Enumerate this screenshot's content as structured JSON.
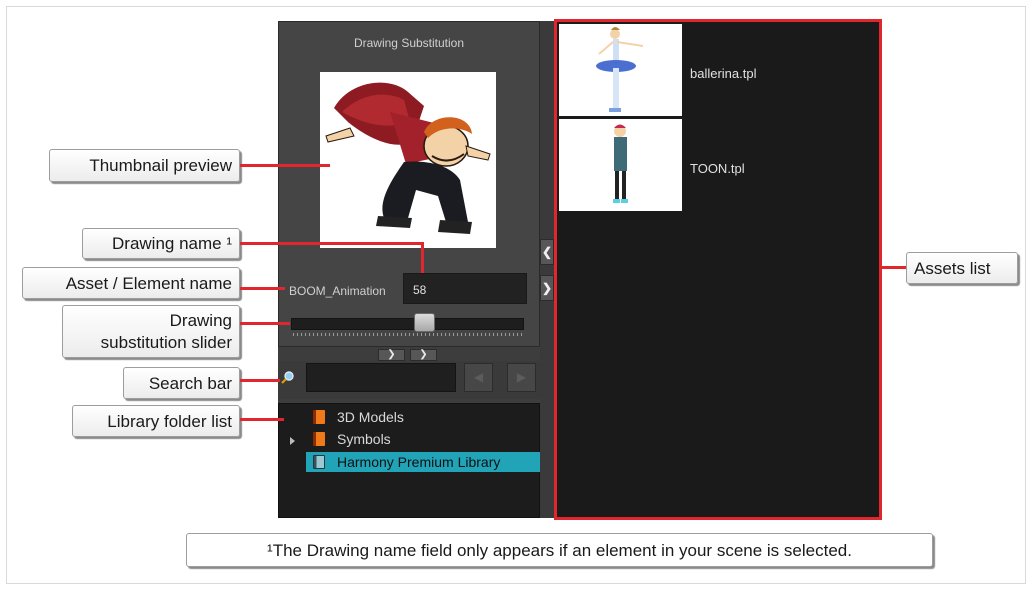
{
  "substitution": {
    "title": "Drawing Substitution",
    "asset_name": "BOOM_Animation",
    "drawing_name": "58",
    "slider_level": 0.58
  },
  "library": {
    "folders": [
      {
        "label": "3D Models",
        "expandable": false,
        "selected": false
      },
      {
        "label": "Symbols",
        "expandable": true,
        "selected": false
      },
      {
        "label": "Harmony Premium Library",
        "expandable": false,
        "selected": true
      }
    ]
  },
  "assets": [
    {
      "name": "ballerina.tpl"
    },
    {
      "name": "TOON.tpl"
    }
  ],
  "callouts": {
    "thumbnail_preview": "Thumbnail preview",
    "drawing_name": "Drawing name ¹",
    "asset_element_name": "Asset / Element name",
    "slider_line1": "Drawing",
    "slider_line2": "substitution slider",
    "search_bar": "Search bar",
    "library_folder_list": "Library folder list",
    "assets_list": "Assets list"
  },
  "footnote": "¹The Drawing name field only appears if an element in your scene is selected.",
  "colors": {
    "callout_line": "#e0272d",
    "selected_folder": "#21a3b8",
    "panel_bg": "#3d3d3d"
  },
  "icons": {
    "search": "magnifier-icon",
    "folder": "library-folder-icon",
    "prev": "chevron-left-icon",
    "next": "chevron-right-icon",
    "up": "chevron-up-icon",
    "down": "chevron-down-icon"
  }
}
